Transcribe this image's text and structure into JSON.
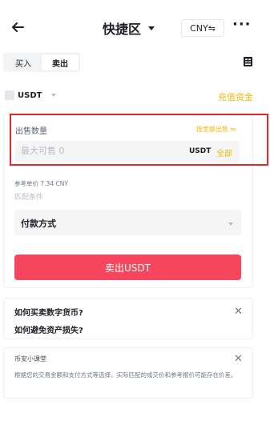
{
  "header": {
    "title": "快捷区",
    "currency_button": "CNY⇋",
    "more": "···"
  },
  "tabs": [
    {
      "label": "买入",
      "active": false
    },
    {
      "label": "卖出",
      "active": true
    }
  ],
  "asset": {
    "name": "USDT",
    "deposit_link": "充值资金"
  },
  "form": {
    "sell_quantity_label": "出售数量",
    "by_amount_link": "按金额出售 ⇋",
    "quantity_placeholder": "最大可售 0",
    "quantity_unit": "USDT",
    "all_button": "全部",
    "reference_price": "参考单价 7.34 CNY",
    "match_conditions": "匹配条件",
    "payment_method": "付款方式",
    "submit_button": "卖出USDT"
  },
  "faq": {
    "q1": "如何买卖数字货币?",
    "q2": "如何避免资产损失?"
  },
  "classroom": {
    "title": "币安小课堂",
    "body": "根据您的交易金额和支付方式等选择，实际匹配的成交价和参考报价可能存在价差。"
  },
  "colors": {
    "accent": "#f0b90b",
    "sell": "#f6465d",
    "highlight": "#e8242b"
  },
  "icons": [
    "back-arrow-icon",
    "chevron-down-icon",
    "more-icon",
    "orders-icon",
    "close-icon"
  ]
}
